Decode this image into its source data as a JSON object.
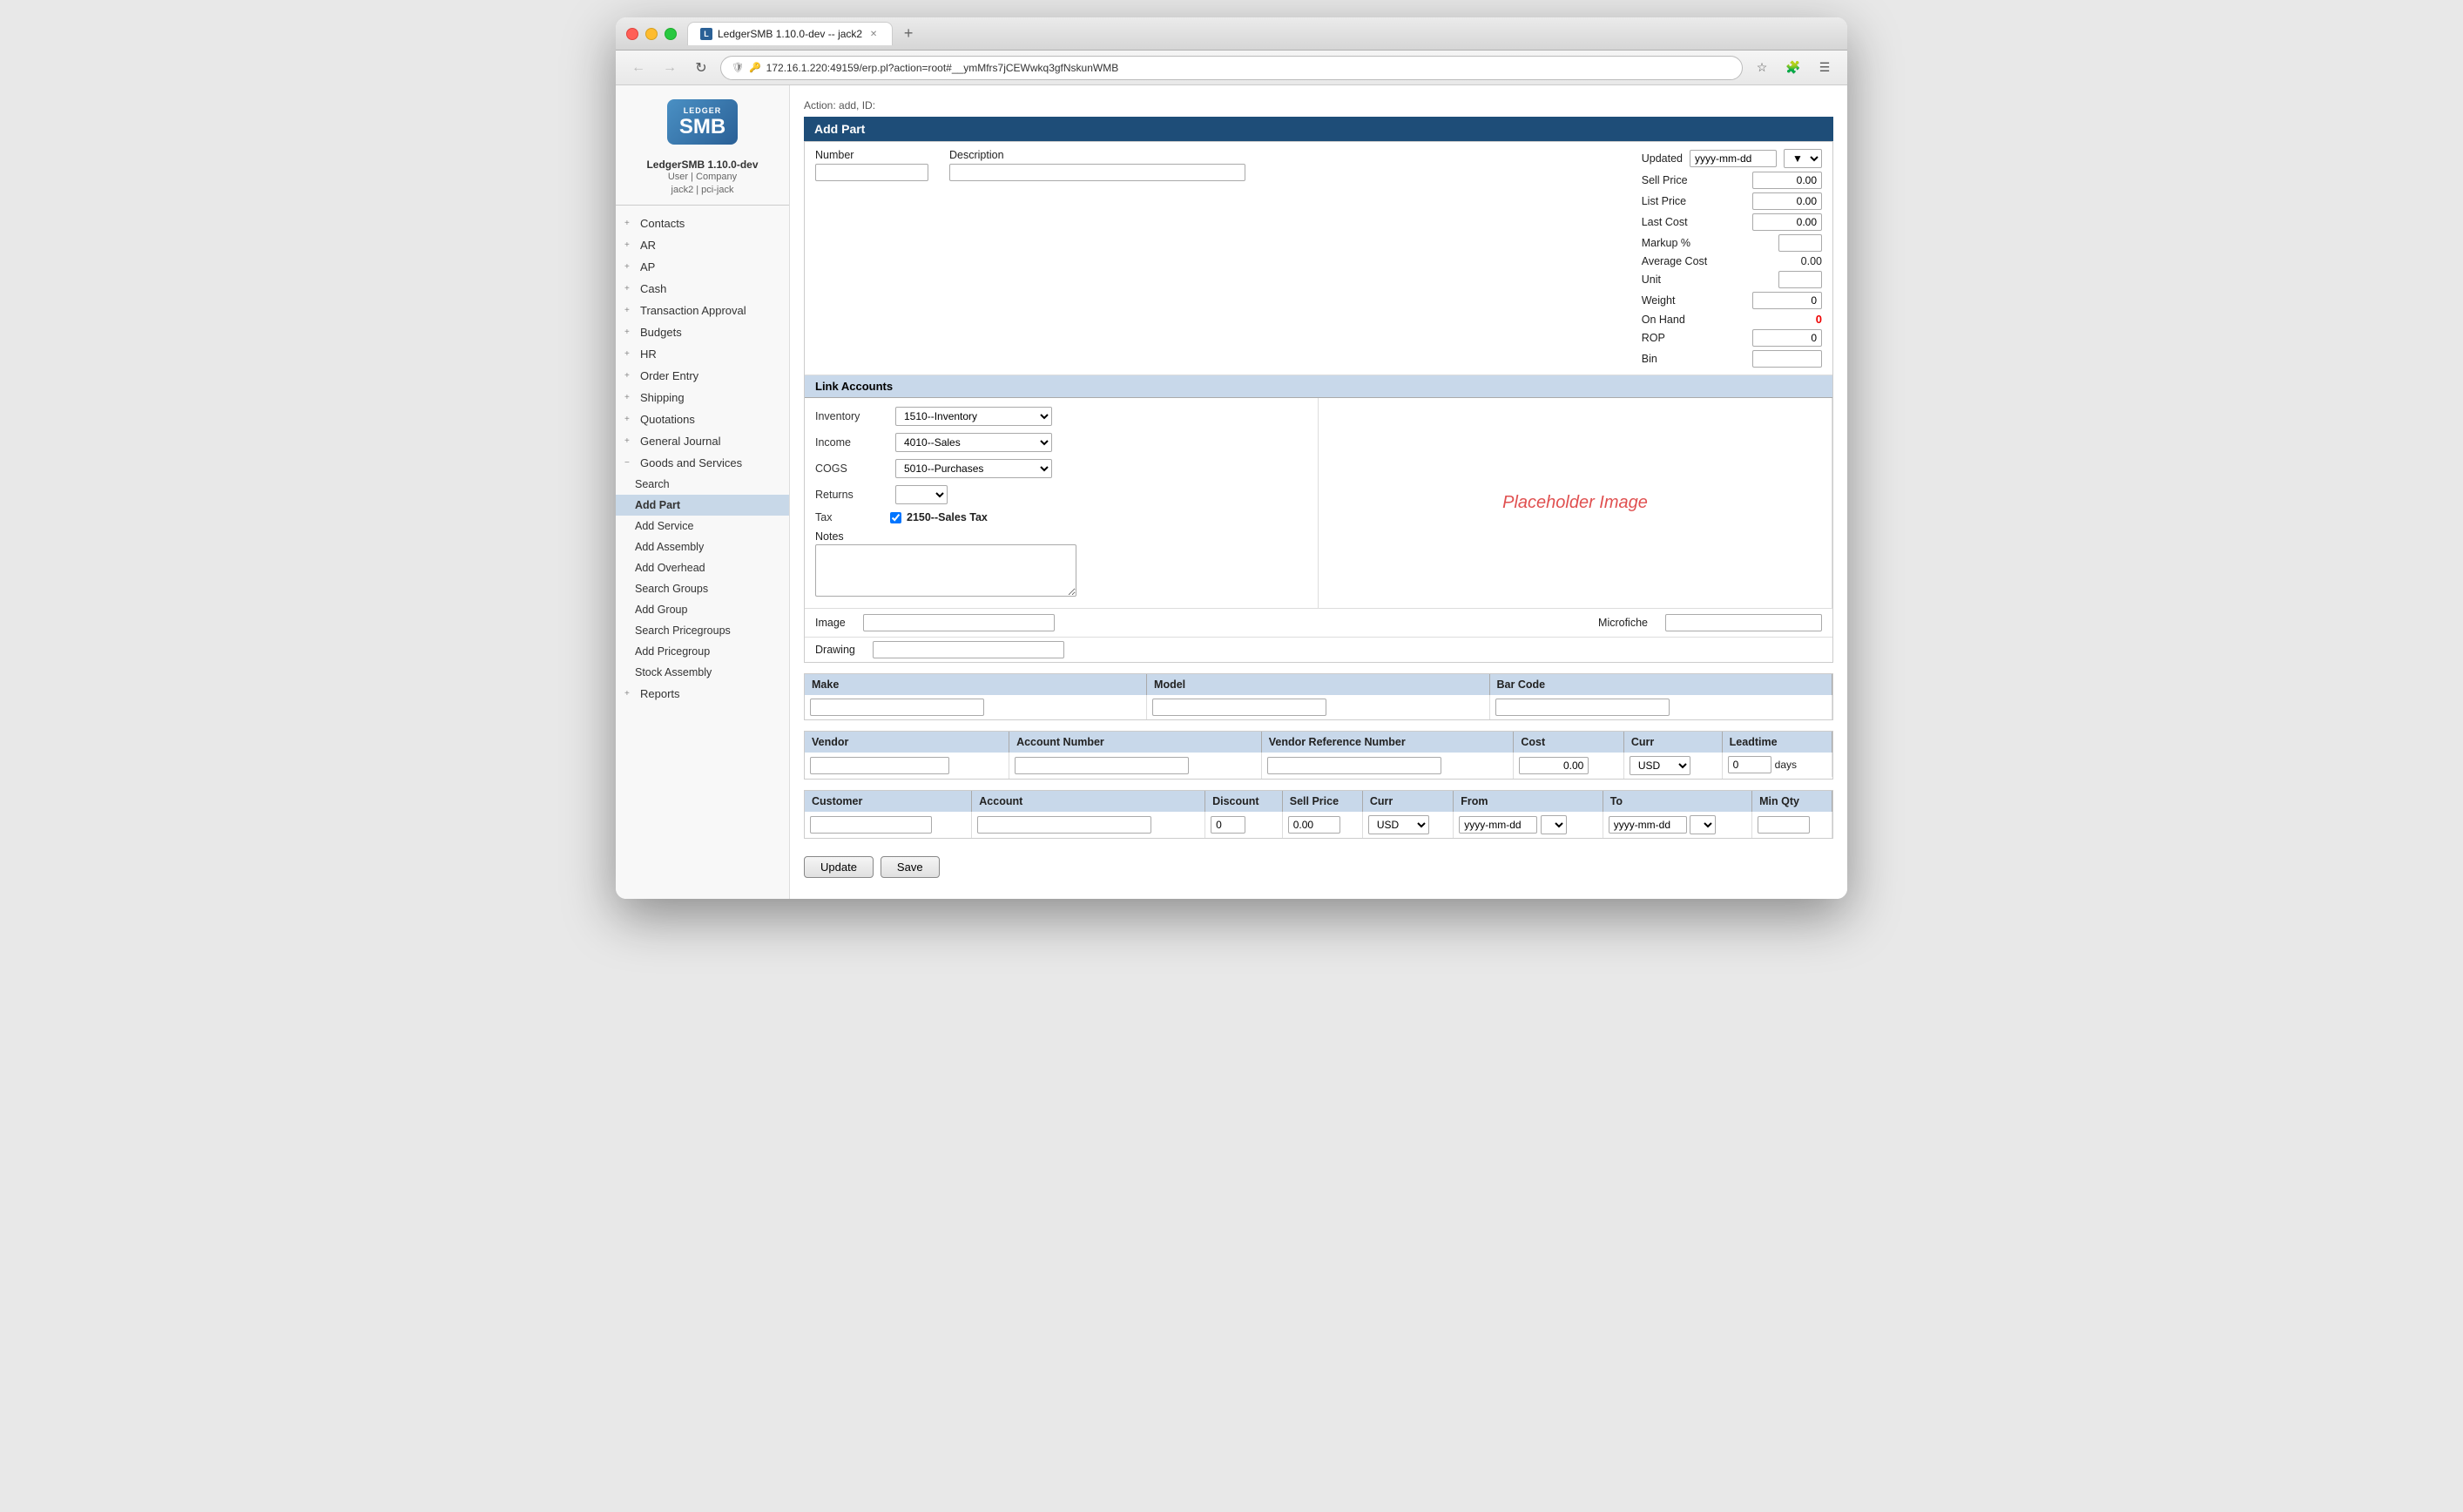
{
  "window": {
    "tab_label": "LedgerSMB 1.10.0-dev -- jack2",
    "tab_favicon": "L",
    "url": "172.16.1.220:49159/erp.pl?action=root#__ymMfrs7jCEWwkq3gfNskunWMB",
    "url_protocol_icon": "🔒",
    "url_shield_icon": "🛡"
  },
  "sidebar": {
    "logo_top": "LEDGER",
    "logo_main": "SMB",
    "app_name": "LedgerSMB 1.10.0-dev",
    "user_label": "User | Company",
    "user_info": "jack2 | pci-jack",
    "items": [
      {
        "id": "contacts",
        "label": "Contacts",
        "level": 0,
        "expandable": true
      },
      {
        "id": "ar",
        "label": "AR",
        "level": 0,
        "expandable": true
      },
      {
        "id": "ap",
        "label": "AP",
        "level": 0,
        "expandable": true
      },
      {
        "id": "cash",
        "label": "Cash",
        "level": 0,
        "expandable": true
      },
      {
        "id": "transaction-approval",
        "label": "Transaction Approval",
        "level": 0,
        "expandable": true
      },
      {
        "id": "budgets",
        "label": "Budgets",
        "level": 0,
        "expandable": true
      },
      {
        "id": "hr",
        "label": "HR",
        "level": 0,
        "expandable": true
      },
      {
        "id": "order-entry",
        "label": "Order Entry",
        "level": 0,
        "expandable": true
      },
      {
        "id": "shipping",
        "label": "Shipping",
        "level": 0,
        "expandable": true
      },
      {
        "id": "quotations",
        "label": "Quotations",
        "level": 0,
        "expandable": true
      },
      {
        "id": "general-journal",
        "label": "General Journal",
        "level": 0,
        "expandable": true
      },
      {
        "id": "goods-and-services",
        "label": "Goods and Services",
        "level": 0,
        "expandable": true,
        "expanded": true
      },
      {
        "id": "search",
        "label": "Search",
        "level": 1
      },
      {
        "id": "add-part",
        "label": "Add Part",
        "level": 1,
        "active": true
      },
      {
        "id": "add-service",
        "label": "Add Service",
        "level": 1
      },
      {
        "id": "add-assembly",
        "label": "Add Assembly",
        "level": 1
      },
      {
        "id": "add-overhead",
        "label": "Add Overhead",
        "level": 1
      },
      {
        "id": "search-groups",
        "label": "Search Groups",
        "level": 1
      },
      {
        "id": "add-group",
        "label": "Add Group",
        "level": 1
      },
      {
        "id": "search-pricegroups",
        "label": "Search Pricegroups",
        "level": 1
      },
      {
        "id": "add-pricegroup",
        "label": "Add Pricegroup",
        "level": 1
      },
      {
        "id": "stock-assembly",
        "label": "Stock Assembly",
        "level": 1
      },
      {
        "id": "reports",
        "label": "Reports",
        "level": 0,
        "expandable": true
      }
    ]
  },
  "main": {
    "action_line": "Action: add, ID:",
    "page_title": "Add Part",
    "fields": {
      "number_label": "Number",
      "number_value": "",
      "description_label": "Description",
      "description_value": ""
    },
    "link_accounts": {
      "header": "Link Accounts",
      "inventory_label": "Inventory",
      "inventory_value": "1510--Inventory",
      "income_label": "Income",
      "income_value": "4010--Sales",
      "cogs_label": "COGS",
      "cogs_value": "5010--Purchases",
      "returns_label": "Returns",
      "returns_value": "",
      "tax_label": "Tax",
      "tax_checked": true,
      "tax_value": "2150--Sales Tax",
      "notes_label": "Notes",
      "notes_value": ""
    },
    "right_panel": {
      "updated_label": "Updated",
      "updated_value": "yyyy-mm-dd",
      "sell_price_label": "Sell Price",
      "sell_price_value": "0.00",
      "list_price_label": "List Price",
      "list_price_value": "0.00",
      "last_cost_label": "Last Cost",
      "last_cost_value": "0.00",
      "markup_label": "Markup %",
      "markup_value": "",
      "average_cost_label": "Average Cost",
      "average_cost_value": "0.00",
      "unit_label": "Unit",
      "unit_value": "",
      "weight_label": "Weight",
      "weight_value": "0",
      "on_hand_label": "On Hand",
      "on_hand_value": "0",
      "rop_label": "ROP",
      "rop_value": "0",
      "bin_label": "Bin",
      "bin_value": ""
    },
    "placeholder_image_text": "Placeholder Image",
    "image_section": {
      "image_label": "Image",
      "image_value": "",
      "microfiche_label": "Microfiche",
      "microfiche_value": "",
      "drawing_label": "Drawing",
      "drawing_value": ""
    },
    "make_model_barcode": {
      "make_label": "Make",
      "make_value": "",
      "model_label": "Model",
      "model_value": "",
      "barcode_label": "Bar Code",
      "barcode_value": ""
    },
    "vendor_section": {
      "vendor_label": "Vendor",
      "account_number_label": "Account Number",
      "vendor_ref_label": "Vendor Reference Number",
      "cost_label": "Cost",
      "cost_value": "0.00",
      "curr_label": "Curr",
      "curr_value": "USD",
      "leadtime_label": "Leadtime",
      "leadtime_value": "0",
      "days_label": "days"
    },
    "customer_section": {
      "customer_label": "Customer",
      "account_label": "Account",
      "discount_label": "Discount",
      "discount_value": "0",
      "sell_price_label": "Sell Price",
      "sell_price_value": "0.00",
      "curr_label": "Curr",
      "curr_value": "USD",
      "from_label": "From",
      "from_value": "yyyy-mm-dd",
      "to_label": "To",
      "to_value": "yyyy-mm-dd",
      "min_qty_label": "Min Qty",
      "min_qty_value": ""
    },
    "buttons": {
      "update_label": "Update",
      "save_label": "Save"
    }
  }
}
